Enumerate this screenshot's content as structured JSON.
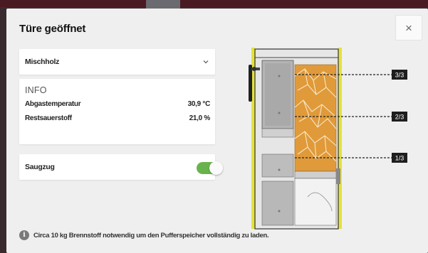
{
  "dialog": {
    "title": "Türe geöffnet",
    "close_icon": "×"
  },
  "fuel_select": {
    "value": "Mischholz"
  },
  "info": {
    "heading": "INFO",
    "rows": [
      {
        "label": "Abgastemperatur",
        "value": "30,9 °C"
      },
      {
        "label": "Restsauerstoff",
        "value": "21,0 %"
      }
    ]
  },
  "draft_toggle": {
    "label": "Saugzug",
    "on": true,
    "on_color": "#69b34c"
  },
  "boiler_diagram": {
    "levels": [
      "3/3",
      "2/3",
      "1/3"
    ],
    "wood_color": "#e09a3a",
    "frame_color": "#e4e23c"
  },
  "footer": {
    "icon": "i",
    "text": "Circa 10 kg Brennstoff notwendig um den Pufferspeicher vollständig zu laden."
  }
}
